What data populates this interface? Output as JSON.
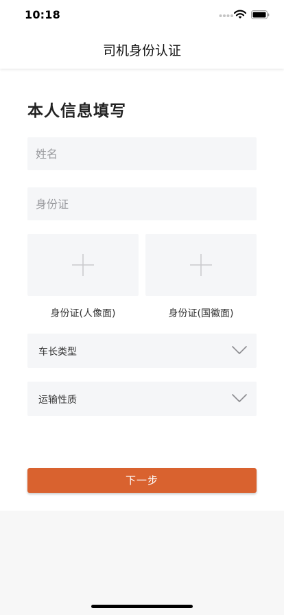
{
  "status_bar": {
    "time": "10:18",
    "icons": [
      "cellular-signal-icon",
      "wifi-icon",
      "battery-icon"
    ]
  },
  "nav": {
    "title": "司机身份认证"
  },
  "form": {
    "section_title": "本人信息填写",
    "name_input": {
      "placeholder": "姓名",
      "value": ""
    },
    "id_input": {
      "placeholder": "身份证",
      "value": ""
    },
    "upload_front": {
      "label": "身份证(人像面)",
      "icon": "plus-icon"
    },
    "upload_back": {
      "label": "身份证(国徽面)",
      "icon": "plus-icon"
    },
    "vehicle_length_select": {
      "label": "车长类型",
      "icon": "chevron-down-icon"
    },
    "transport_type_select": {
      "label": "运输性质",
      "icon": "chevron-down-icon"
    },
    "next_button_label": "下一步"
  },
  "colors": {
    "accent": "#d9622f",
    "field_background": "#f5f6f8",
    "page_background": "#f7f7f7"
  }
}
